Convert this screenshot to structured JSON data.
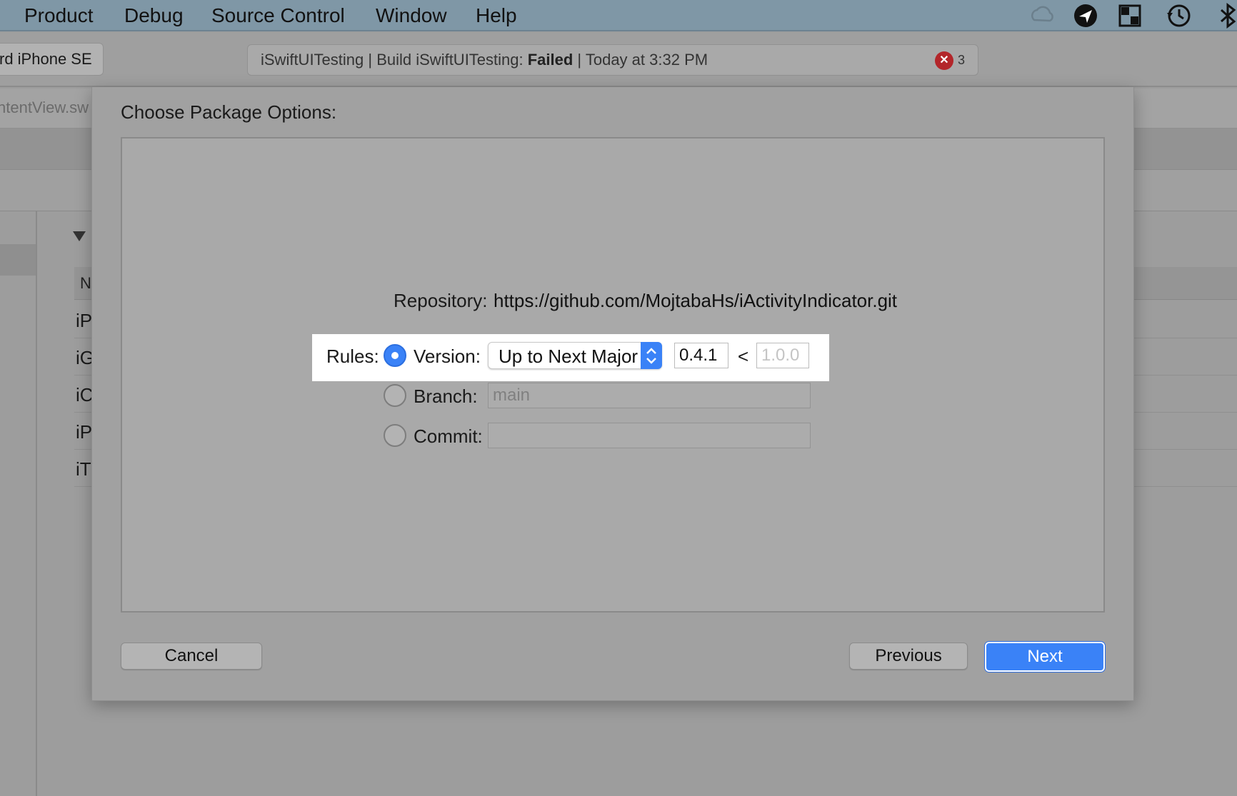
{
  "menubar": {
    "items": [
      "Product",
      "Debug",
      "Source Control",
      "Window",
      "Help"
    ],
    "status_icons": [
      "creative-cloud-icon",
      "navigation-arrow-icon",
      "window-layout-icon",
      "time-machine-icon",
      "bluetooth-icon"
    ]
  },
  "toolbar": {
    "scheme_label": "rd iPhone SE",
    "activity": {
      "project": "iSwiftUITesting | Build iSwiftUITesting: ",
      "status": "Failed",
      "time": " | Today at 3:32 PM",
      "error_count": "3"
    }
  },
  "editor": {
    "tab_label": "ntentView.sw",
    "list_header": "N",
    "rows": [
      "iP",
      "iG",
      "iC",
      "iP",
      "iT"
    ]
  },
  "sheet": {
    "title": "Choose Package Options:",
    "repository_label": "Repository:",
    "repository_url": "https://github.com/MojtabaHs/iActivityIndicator.git",
    "rules_label": "Rules:",
    "version_label": "Version:",
    "version_rule": "Up to Next Major",
    "version_from": "0.4.1",
    "version_separator": "<",
    "version_to": "1.0.0",
    "branch_label": "Branch:",
    "branch_value": "main",
    "commit_label": "Commit:",
    "commit_value": "",
    "selected_rule": "version",
    "cancel_label": "Cancel",
    "previous_label": "Previous",
    "next_label": "Next"
  },
  "colors": {
    "accent": "#3a82f7",
    "error": "#b3262a"
  }
}
